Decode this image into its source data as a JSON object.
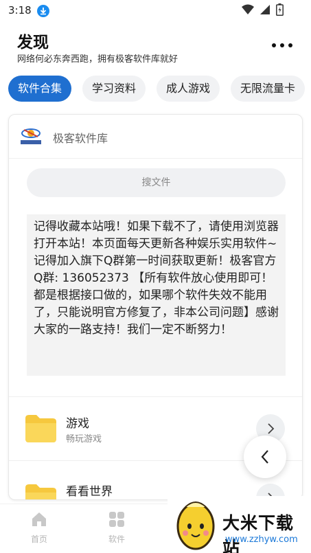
{
  "status_bar": {
    "time": "3:18"
  },
  "header": {
    "title": "发现",
    "subtitle": "网络何必东奔西跑，拥有极客软件库就好"
  },
  "tabs": [
    {
      "label": "软件合集",
      "active": true
    },
    {
      "label": "学习资料",
      "active": false
    },
    {
      "label": "成人游戏",
      "active": false
    },
    {
      "label": "无限流量卡",
      "active": false
    }
  ],
  "card": {
    "site_name": "极客软件库",
    "search_placeholder": "搜文件",
    "notice": "记得收藏本站哦！如果下载不了，请使用浏览器打开本站！本页面每天更新各种娱乐实用软件~记得加入旗下Q群第一时间获取更新！极客官方Q群: 136052373 【所有软件放心使用即可！都是根据接口做的，如果哪个软件失效不能用了，只能说明官方修复了，非本公司问题】感谢大家的一路支持！我们一定不断努力！",
    "categories": [
      {
        "title": "游戏",
        "subtitle": "畅玩游戏"
      },
      {
        "title": "看看世界",
        "subtitle": ""
      }
    ]
  },
  "bottom_nav": [
    {
      "label": "首页",
      "icon": "home-icon"
    },
    {
      "label": "软件",
      "icon": "apps-grid-icon"
    }
  ],
  "watermark": {
    "title": "大米下载站",
    "url": "www.zzhyw.com"
  },
  "colors": {
    "accent": "#1f6fd0",
    "folder": "#f6c83e",
    "download_badge": "#1a8cf0",
    "watermark_url": "#1a78d8"
  }
}
